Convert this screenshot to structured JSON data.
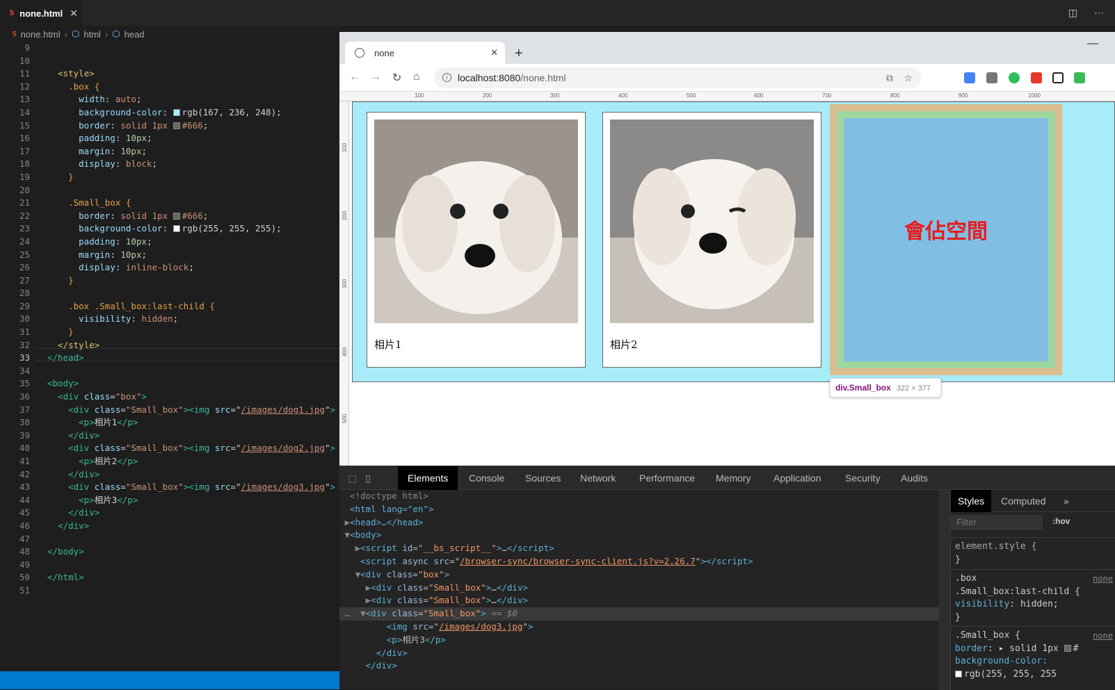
{
  "editor": {
    "tab_label": "none.html",
    "tab_icon": "5",
    "breadcrumb": [
      "none.html",
      "html",
      "head"
    ],
    "line_numbers": [
      "9",
      "10",
      "11",
      "12",
      "13",
      "14",
      "15",
      "16",
      "17",
      "18",
      "19",
      "20",
      "21",
      "22",
      "23",
      "24",
      "25",
      "26",
      "27",
      "28",
      "29",
      "30",
      "31",
      "32",
      "33",
      "34",
      "35",
      "36",
      "37",
      "38",
      "39",
      "40",
      "41",
      "42",
      "43",
      "44",
      "45",
      "46",
      "47",
      "48",
      "49",
      "50",
      "51"
    ],
    "current_line": "33"
  },
  "code": {
    "l11": "<style>",
    "l12_sel": ".box {",
    "l13_p": "width",
    "l13_v": "auto",
    "l14_p": "background-color",
    "l14_v": "rgb(167, 236, 248)",
    "l15_p": "border",
    "l15_v": "solid 1px",
    "l15_c": "#666",
    "l16_p": "padding",
    "l16_v": "10px",
    "l17_p": "margin",
    "l17_v": "10px",
    "l18_p": "display",
    "l18_v": "block",
    "close": "}",
    "l21_sel": ".Small_box {",
    "l22_p": "border",
    "l22_v": "solid 1px",
    "l22_c": "#666",
    "l23_p": "background-color",
    "l23_v": "rgb(255, 255, 255)",
    "l24_p": "padding",
    "l24_v": "10px",
    "l25_p": "margin",
    "l25_v": "10px",
    "l26_p": "display",
    "l26_v": "inline-block",
    "l29_sel": ".box .Small_box:last-child {",
    "l30_p": "visibility",
    "l30_v": "hidden",
    "l32": "</style>",
    "l33": "</head>",
    "l35": "<body>",
    "l36": "<div class=\"box\">",
    "img1": "/images/dog1.jpg",
    "img2": "/images/dog2.jpg",
    "img3": "/images/dog3.jpg",
    "p1": "相片1",
    "p2": "相片2",
    "p3": "相片3",
    "l46": "</div>",
    "l48": "</body>",
    "l50": "</html>"
  },
  "browser": {
    "tab_title": "none",
    "url_host": "localhost:8080",
    "url_path": "/none.html",
    "ruler_ticks": [
      "100",
      "200",
      "300",
      "400",
      "500",
      "600",
      "700",
      "800",
      "900",
      "1000"
    ],
    "vruler_ticks": [
      "100",
      "200",
      "300",
      "400",
      "500"
    ],
    "cards": [
      {
        "caption": "相片1"
      },
      {
        "caption": "相片2"
      }
    ],
    "hidden_label": "會佔空間",
    "tooltip_name": "div.Small_box",
    "tooltip_size": "322 × 377"
  },
  "devtools": {
    "tabs": [
      "Elements",
      "Console",
      "Sources",
      "Network",
      "Performance",
      "Memory",
      "Application",
      "Security",
      "Audits"
    ],
    "active_tab": "Elements",
    "dom": {
      "doctype": "<!doctype html>",
      "html": "<html lang=\"en\">",
      "head": "<head>…</head>",
      "body": "<body>",
      "script1_id": "__bs_script__",
      "script2_src": "/browser-sync/browser-sync-client.js?v=2.26.7",
      "div_box": "box",
      "small_box": "Small_box",
      "sel_marker": "== $0",
      "img_src": "/images/dog3.jpg",
      "p_text": "相片3",
      "close_div": "</div>"
    },
    "styles_tabs": [
      "Styles",
      "Computed"
    ],
    "filter_placeholder": "Filter",
    "hov": ":hov",
    "element_style": "element.style {",
    "rule1_sel1": ".box",
    "rule1_sel2": ".Small_box:last-child {",
    "rule1_prop": "visibility",
    "rule1_val": "hidden;",
    "rule_src": "none",
    "rule2_sel": ".Small_box {",
    "rule2_p1": "border",
    "rule2_v1": "solid 1px",
    "rule2_p2": "background-color:",
    "rule2_v2": "rgb(255, 255, 255"
  },
  "colors": {
    "box_bg": "#a7ecf8",
    "accent": "#007acc",
    "hidden_text": "#e81c1c"
  }
}
